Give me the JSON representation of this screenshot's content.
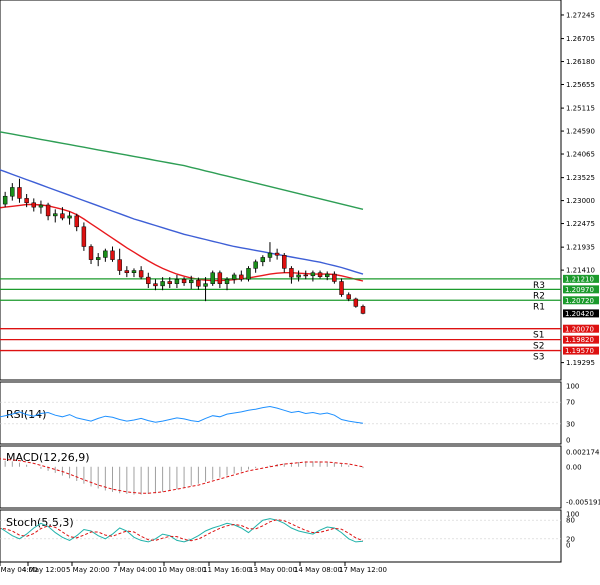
{
  "colors": {
    "background": "#ffffff",
    "frame": "#000000",
    "candle_bull": "#1b8f1b",
    "candle_bear": "#dd1111",
    "ma_fast": "#e8191e",
    "ma_mid": "#3e5fd6",
    "ma_slow": "#2e9e55",
    "resistance": "#1b9a2c",
    "support": "#dd1111",
    "price_tag": "#000000",
    "rsi_line": "#1e90ff",
    "macd_hist": "#a0a0a0",
    "macd_signal": "#dd1111",
    "stoch_main": "#20b2aa",
    "stoch_signal": "#dd1111",
    "grid": "#d0d0d0"
  },
  "chart_data": [
    {
      "type": "candlestick",
      "title": "",
      "y_ticks": [
        "1.27245",
        "1.26705",
        "1.26180",
        "1.25655",
        "1.25115",
        "1.24590",
        "1.24065",
        "1.23525",
        "1.23000",
        "1.22475",
        "1.21935",
        "1.21410"
      ],
      "ylim": [
        1.1908,
        1.2745
      ],
      "x_ticks": [
        "4 May 04:00",
        "4 May 12:00",
        "5 May 20:00",
        "7 May 04:00",
        "10 May 08:00",
        "11 May 16:00",
        "13 May 00:00",
        "14 May 08:00",
        "17 May 12:00"
      ],
      "candles": [
        {
          "o": 1.2275,
          "h": 1.23,
          "l": 1.2268,
          "c": 1.2292
        },
        {
          "o": 1.2292,
          "h": 1.232,
          "l": 1.2285,
          "c": 1.231
        },
        {
          "o": 1.231,
          "h": 1.234,
          "l": 1.23,
          "c": 1.233
        },
        {
          "o": 1.233,
          "h": 1.235,
          "l": 1.2295,
          "c": 1.2305
        },
        {
          "o": 1.2305,
          "h": 1.2315,
          "l": 1.2285,
          "c": 1.2295
        },
        {
          "o": 1.2295,
          "h": 1.2305,
          "l": 1.2275,
          "c": 1.2285
        },
        {
          "o": 1.2285,
          "h": 1.23,
          "l": 1.227,
          "c": 1.229
        },
        {
          "o": 1.229,
          "h": 1.2295,
          "l": 1.2255,
          "c": 1.2265
        },
        {
          "o": 1.2265,
          "h": 1.228,
          "l": 1.225,
          "c": 1.227
        },
        {
          "o": 1.227,
          "h": 1.2285,
          "l": 1.2255,
          "c": 1.226
        },
        {
          "o": 1.226,
          "h": 1.2275,
          "l": 1.2245,
          "c": 1.2265
        },
        {
          "o": 1.2265,
          "h": 1.227,
          "l": 1.223,
          "c": 1.224
        },
        {
          "o": 1.224,
          "h": 1.225,
          "l": 1.2185,
          "c": 1.2195
        },
        {
          "o": 1.2195,
          "h": 1.22,
          "l": 1.2155,
          "c": 1.2165
        },
        {
          "o": 1.2165,
          "h": 1.218,
          "l": 1.215,
          "c": 1.217
        },
        {
          "o": 1.217,
          "h": 1.219,
          "l": 1.216,
          "c": 1.2185
        },
        {
          "o": 1.2185,
          "h": 1.2195,
          "l": 1.216,
          "c": 1.2165
        },
        {
          "o": 1.2165,
          "h": 1.219,
          "l": 1.213,
          "c": 1.214
        },
        {
          "o": 1.214,
          "h": 1.215,
          "l": 1.2125,
          "c": 1.2135
        },
        {
          "o": 1.2135,
          "h": 1.2145,
          "l": 1.2125,
          "c": 1.214
        },
        {
          "o": 1.214,
          "h": 1.215,
          "l": 1.212,
          "c": 1.2125
        },
        {
          "o": 1.2125,
          "h": 1.2135,
          "l": 1.21,
          "c": 1.211
        },
        {
          "o": 1.211,
          "h": 1.212,
          "l": 1.2095,
          "c": 1.2105
        },
        {
          "o": 1.2105,
          "h": 1.2125,
          "l": 1.2095,
          "c": 1.2115
        },
        {
          "o": 1.2115,
          "h": 1.2125,
          "l": 1.21,
          "c": 1.211
        },
        {
          "o": 1.211,
          "h": 1.213,
          "l": 1.21,
          "c": 1.212
        },
        {
          "o": 1.212,
          "h": 1.2125,
          "l": 1.2105,
          "c": 1.2112
        },
        {
          "o": 1.2112,
          "h": 1.2128,
          "l": 1.2098,
          "c": 1.2118
        },
        {
          "o": 1.2118,
          "h": 1.2124,
          "l": 1.2096,
          "c": 1.2104
        },
        {
          "o": 1.2104,
          "h": 1.2125,
          "l": 1.207,
          "c": 1.211
        },
        {
          "o": 1.211,
          "h": 1.214,
          "l": 1.2105,
          "c": 1.2135
        },
        {
          "o": 1.2135,
          "h": 1.214,
          "l": 1.21,
          "c": 1.211
        },
        {
          "o": 1.211,
          "h": 1.2125,
          "l": 1.2095,
          "c": 1.212
        },
        {
          "o": 1.212,
          "h": 1.2135,
          "l": 1.211,
          "c": 1.213
        },
        {
          "o": 1.213,
          "h": 1.214,
          "l": 1.2115,
          "c": 1.212
        },
        {
          "o": 1.212,
          "h": 1.215,
          "l": 1.2115,
          "c": 1.2145
        },
        {
          "o": 1.2145,
          "h": 1.2165,
          "l": 1.2135,
          "c": 1.216
        },
        {
          "o": 1.216,
          "h": 1.2175,
          "l": 1.215,
          "c": 1.217
        },
        {
          "o": 1.217,
          "h": 1.2205,
          "l": 1.216,
          "c": 1.218
        },
        {
          "o": 1.218,
          "h": 1.219,
          "l": 1.2165,
          "c": 1.2175
        },
        {
          "o": 1.2175,
          "h": 1.218,
          "l": 1.2135,
          "c": 1.2145
        },
        {
          "o": 1.2145,
          "h": 1.215,
          "l": 1.211,
          "c": 1.2125
        },
        {
          "o": 1.2125,
          "h": 1.214,
          "l": 1.2115,
          "c": 1.213
        },
        {
          "o": 1.213,
          "h": 1.214,
          "l": 1.212,
          "c": 1.2128
        },
        {
          "o": 1.2128,
          "h": 1.214,
          "l": 1.2115,
          "c": 1.2135
        },
        {
          "o": 1.2135,
          "h": 1.214,
          "l": 1.2122,
          "c": 1.2126
        },
        {
          "o": 1.2126,
          "h": 1.2138,
          "l": 1.2118,
          "c": 1.2132
        },
        {
          "o": 1.2132,
          "h": 1.2138,
          "l": 1.211,
          "c": 1.2115
        },
        {
          "o": 1.2115,
          "h": 1.2122,
          "l": 1.208,
          "c": 1.2085
        },
        {
          "o": 1.2085,
          "h": 1.209,
          "l": 1.207,
          "c": 1.2075
        },
        {
          "o": 1.2075,
          "h": 1.2078,
          "l": 1.2055,
          "c": 1.2058
        },
        {
          "o": 1.2058,
          "h": 1.2062,
          "l": 1.204,
          "c": 1.2042
        }
      ],
      "series": [
        {
          "name": "",
          "color_key": "ma_fast",
          "values": [
            1.2283,
            1.2285,
            1.2287,
            1.2289,
            1.2291,
            1.2291,
            1.229,
            1.2288,
            1.2284,
            1.228,
            1.2275,
            1.2268,
            1.2258,
            1.2247,
            1.2236,
            1.2225,
            1.2214,
            1.2203,
            1.2192,
            1.2182,
            1.2172,
            1.2162,
            1.2153,
            1.2145,
            1.2138,
            1.2132,
            1.2127,
            1.2123,
            1.212,
            1.2118,
            1.2117,
            1.2117,
            1.2118,
            1.2119,
            1.2121,
            1.2123,
            1.2126,
            1.2129,
            1.2132,
            1.2134,
            1.2135,
            1.2135,
            1.2134,
            1.2133,
            1.2132,
            1.2132,
            1.2132,
            1.2131,
            1.2128,
            1.2124,
            1.212,
            1.2116
          ]
        },
        {
          "name": "",
          "color_key": "ma_mid",
          "values": [
            1.2372,
            1.2366,
            1.236,
            1.2354,
            1.2348,
            1.2342,
            1.2336,
            1.233,
            1.2324,
            1.2318,
            1.2312,
            1.2306,
            1.23,
            1.2294,
            1.2288,
            1.2282,
            1.2276,
            1.227,
            1.2264,
            1.2258,
            1.2253,
            1.2248,
            1.2243,
            1.2238,
            1.2233,
            1.2228,
            1.2223,
            1.2219,
            1.2215,
            1.2211,
            1.2207,
            1.2203,
            1.2199,
            1.2195,
            1.2192,
            1.2189,
            1.2186,
            1.2183,
            1.218,
            1.2177,
            1.2174,
            1.2171,
            1.2168,
            1.2165,
            1.2162,
            1.2159,
            1.2155,
            1.2151,
            1.2147,
            1.2142,
            1.2137,
            1.2132
          ]
        },
        {
          "name": "",
          "color_key": "ma_slow",
          "values": [
            1.2458,
            1.2455,
            1.2452,
            1.2449,
            1.2446,
            1.2443,
            1.244,
            1.2437,
            1.2434,
            1.2431,
            1.2428,
            1.2425,
            1.2422,
            1.2419,
            1.2416,
            1.2413,
            1.241,
            1.2407,
            1.2404,
            1.2401,
            1.2398,
            1.2395,
            1.2392,
            1.2389,
            1.2386,
            1.2383,
            1.238,
            1.2376,
            1.2372,
            1.2368,
            1.2364,
            1.236,
            1.2356,
            1.2352,
            1.2348,
            1.2344,
            1.234,
            1.2336,
            1.2332,
            1.2328,
            1.2324,
            1.232,
            1.2316,
            1.2312,
            1.2308,
            1.2304,
            1.23,
            1.2296,
            1.2292,
            1.2288,
            1.2284,
            1.228
          ]
        }
      ],
      "levels": [
        {
          "name": "R3",
          "value": 1.2121,
          "tag": "1.21210",
          "kind": "resistance"
        },
        {
          "name": "R2",
          "value": 1.2097,
          "tag": "1.20970",
          "kind": "resistance"
        },
        {
          "name": "R1",
          "value": 1.2072,
          "tag": "1.20720",
          "kind": "resistance"
        },
        {
          "name": "S1",
          "value": 1.2007,
          "tag": "1.20070",
          "kind": "support"
        },
        {
          "name": "S2",
          "value": 1.1982,
          "tag": "1.19820",
          "kind": "support"
        },
        {
          "name": "S3",
          "value": 1.1957,
          "tag": "1.19570",
          "kind": "support"
        }
      ],
      "current_price": "1.20420",
      "bottom_tick": "1.19295"
    },
    {
      "type": "line",
      "title": "RSI(14)",
      "y_ticks": [
        "100",
        "70",
        "30",
        "0"
      ],
      "ylim": [
        0,
        100
      ],
      "values": [
        42,
        45,
        48,
        52,
        47,
        44,
        49,
        51,
        46,
        43,
        47,
        41,
        38,
        35,
        40,
        44,
        42,
        38,
        35,
        37,
        40,
        36,
        33,
        35,
        38,
        41,
        39,
        36,
        34,
        40,
        45,
        43,
        48,
        50,
        52,
        55,
        57,
        60,
        62,
        59,
        55,
        51,
        53,
        49,
        51,
        48,
        50,
        46,
        38,
        35,
        33,
        31
      ]
    },
    {
      "type": "bar",
      "title": "MACD(12,26,9)",
      "y_ticks": [
        "0.002174",
        "0.00",
        "-0.005191"
      ],
      "ylim": [
        -0.005191,
        0.002174
      ],
      "values": [
        0.001,
        0.0009,
        0.0008,
        0.0006,
        0.0003,
        0.0,
        -0.0003,
        -0.0006,
        -0.0009,
        -0.0013,
        -0.0017,
        -0.0021,
        -0.0025,
        -0.0029,
        -0.0032,
        -0.0035,
        -0.0037,
        -0.0039,
        -0.004,
        -0.0041,
        -0.0041,
        -0.004,
        -0.0039,
        -0.0037,
        -0.0035,
        -0.0033,
        -0.0031,
        -0.0028,
        -0.0025,
        -0.0022,
        -0.0019,
        -0.0016,
        -0.0013,
        -0.001,
        -0.0007,
        -0.0004,
        -0.0002,
        0.0,
        0.0002,
        0.0004,
        0.0005,
        0.0006,
        0.0007,
        0.0008,
        0.0008,
        0.0008,
        0.0007,
        0.0006,
        0.0004,
        0.0002,
        0.0,
        -0.0002
      ],
      "signal": [
        0.0012,
        0.0011,
        0.001,
        0.0009,
        0.0007,
        0.0005,
        0.0002,
        -0.0001,
        -0.0004,
        -0.0007,
        -0.0011,
        -0.0015,
        -0.0019,
        -0.0023,
        -0.0027,
        -0.003,
        -0.0033,
        -0.0035,
        -0.0037,
        -0.0038,
        -0.0039,
        -0.0039,
        -0.0038,
        -0.0037,
        -0.0035,
        -0.0033,
        -0.0031,
        -0.0029,
        -0.0027,
        -0.0024,
        -0.0021,
        -0.0018,
        -0.0015,
        -0.0012,
        -0.0009,
        -0.0006,
        -0.0004,
        -0.0002,
        0.0,
        0.0002,
        0.0004,
        0.0005,
        0.0006,
        0.0007,
        0.0007,
        0.0007,
        0.0007,
        0.0006,
        0.0005,
        0.0004,
        0.0002,
        0.0
      ]
    },
    {
      "type": "line",
      "title": "Stoch(5,5,3)",
      "y_ticks": [
        "100",
        "80",
        "20",
        "0"
      ],
      "ylim": [
        0,
        100
      ],
      "values": [
        60,
        45,
        30,
        20,
        35,
        55,
        70,
        60,
        40,
        25,
        15,
        30,
        50,
        45,
        30,
        20,
        35,
        55,
        45,
        25,
        15,
        10,
        20,
        35,
        30,
        15,
        10,
        18,
        30,
        45,
        55,
        62,
        70,
        65,
        55,
        40,
        60,
        80,
        85,
        80,
        70,
        55,
        45,
        40,
        35,
        48,
        58,
        55,
        40,
        20,
        10,
        12
      ],
      "signal": [
        55,
        52,
        45,
        32,
        28,
        37,
        53,
        62,
        57,
        42,
        27,
        23,
        32,
        42,
        42,
        32,
        28,
        37,
        45,
        42,
        28,
        17,
        15,
        22,
        28,
        27,
        18,
        14,
        19,
        31,
        43,
        54,
        62,
        66,
        63,
        53,
        52,
        62,
        75,
        82,
        78,
        68,
        57,
        47,
        40,
        41,
        47,
        54,
        51,
        38,
        23,
        14
      ]
    }
  ]
}
